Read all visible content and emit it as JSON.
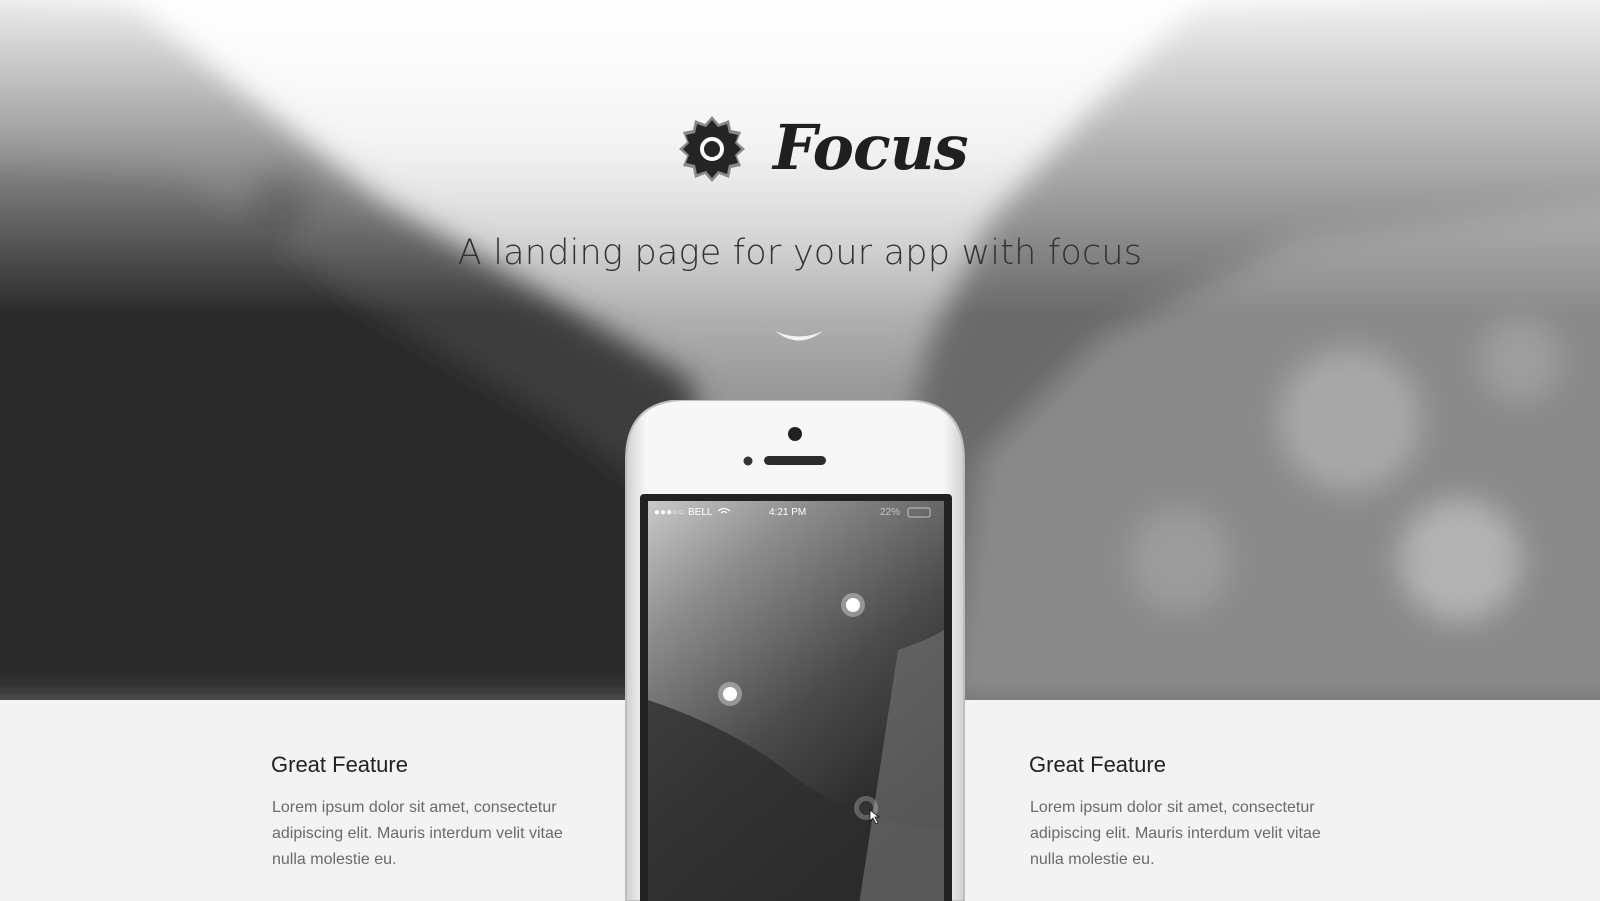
{
  "brand": {
    "name": "Focus",
    "logo_icon": "aperture-badge-icon"
  },
  "hero": {
    "tagline": "A landing page for your app with focus",
    "scroll_icon": "chevron-down-icon"
  },
  "phone": {
    "status": {
      "signal": "●●●○○",
      "carrier": "BELL",
      "time": "4:21 PM",
      "battery": "22%"
    },
    "focus_points": [
      "focus-point",
      "focus-point",
      "focus-point"
    ]
  },
  "features": [
    {
      "title": "Great Feature",
      "text": "Lorem ipsum dolor sit amet, consectetur adipiscing elit. Mauris interdum velit vitae nulla molestie eu."
    },
    {
      "title": "Great Feature",
      "text": "Lorem ipsum dolor sit amet, consectetur adipiscing elit. Mauris interdum velit vitae nulla molestie eu."
    }
  ],
  "colors": {
    "text_dark": "#1f1f1f",
    "page_bg": "#f3f3f3",
    "body_text": "#6a6a6a"
  }
}
